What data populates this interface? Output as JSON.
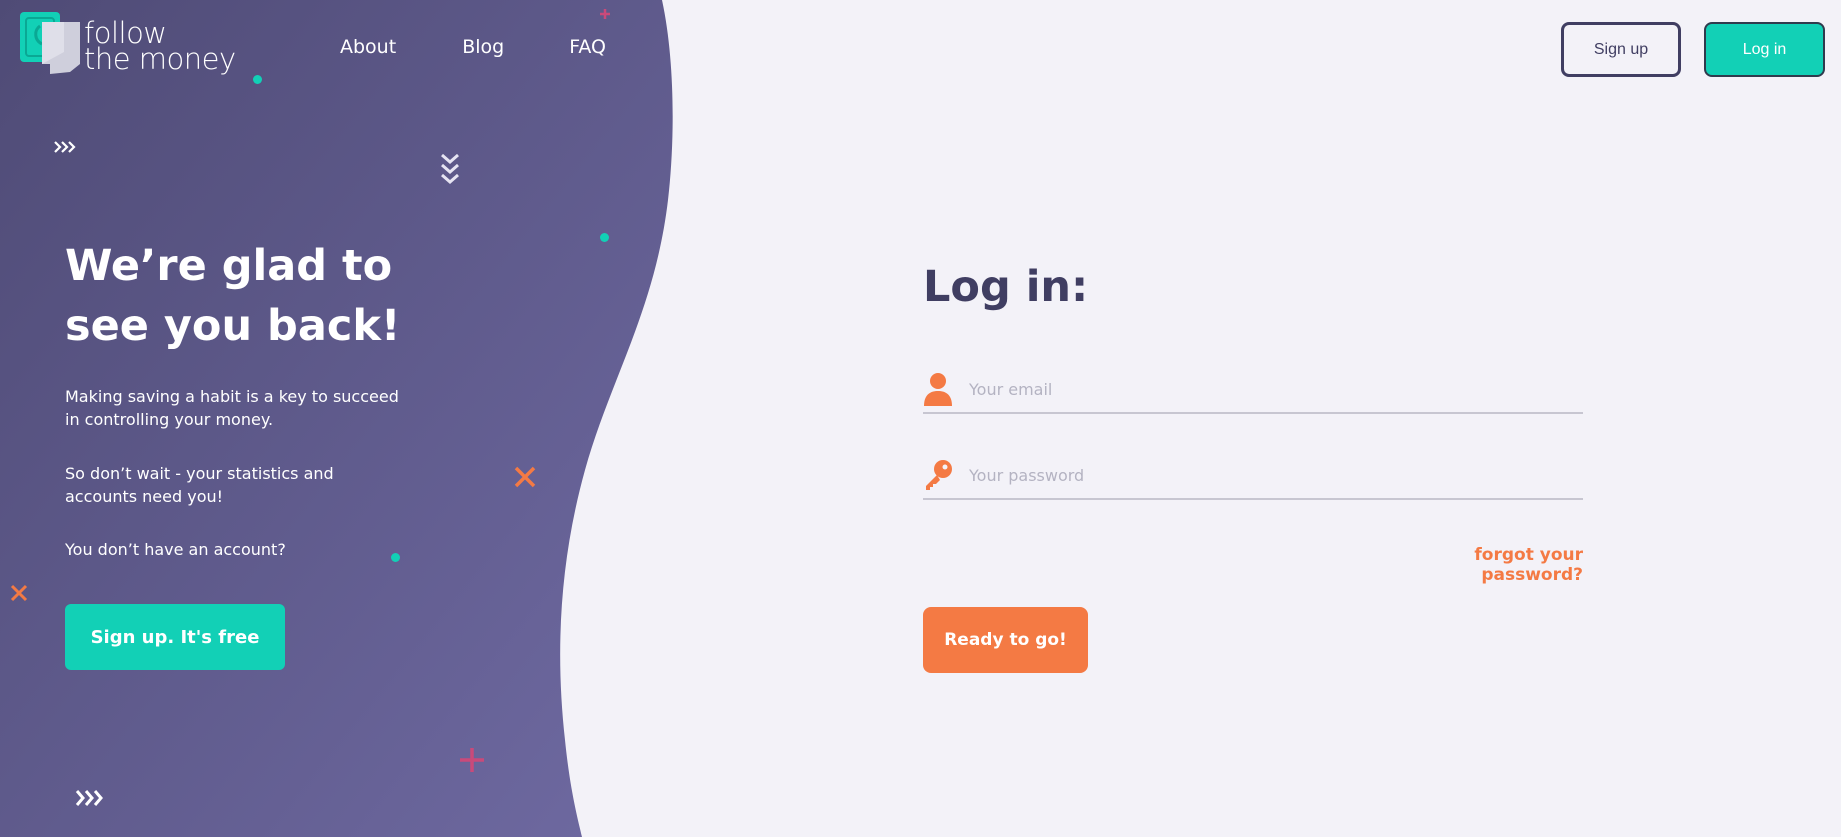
{
  "colors": {
    "purple_dark": "#4f4b76",
    "purple_light": "#6e69a0",
    "teal": "#12d0b6",
    "orange": "#f47a44",
    "magenta": "#c94a7a",
    "background": "#f3f2f8",
    "text_dark": "#403e62"
  },
  "logo": {
    "line1": "follow",
    "line2": "the money",
    "icon": "money-logo-icon"
  },
  "nav": {
    "items": [
      {
        "label": "About"
      },
      {
        "label": "Blog"
      },
      {
        "label": "FAQ"
      }
    ]
  },
  "header": {
    "signup_label": "Sign up",
    "login_label": "Log in"
  },
  "hero": {
    "title_line1": "We’re glad to",
    "title_line2": "see you back!",
    "paragraph1": "Making saving a habit is a key to succeed in controlling your money.",
    "paragraph2": "So don’t wait - your statistics and accounts need you!",
    "paragraph3": "You don’t have an account?",
    "cta_label": "Sign up. It's free"
  },
  "login": {
    "title": "Log in:",
    "email_placeholder": "Your email",
    "email_icon": "user-icon",
    "password_placeholder": "Your password",
    "password_icon": "key-icon",
    "forgot_label": "forgot your password?",
    "submit_label": "Ready to go!"
  }
}
